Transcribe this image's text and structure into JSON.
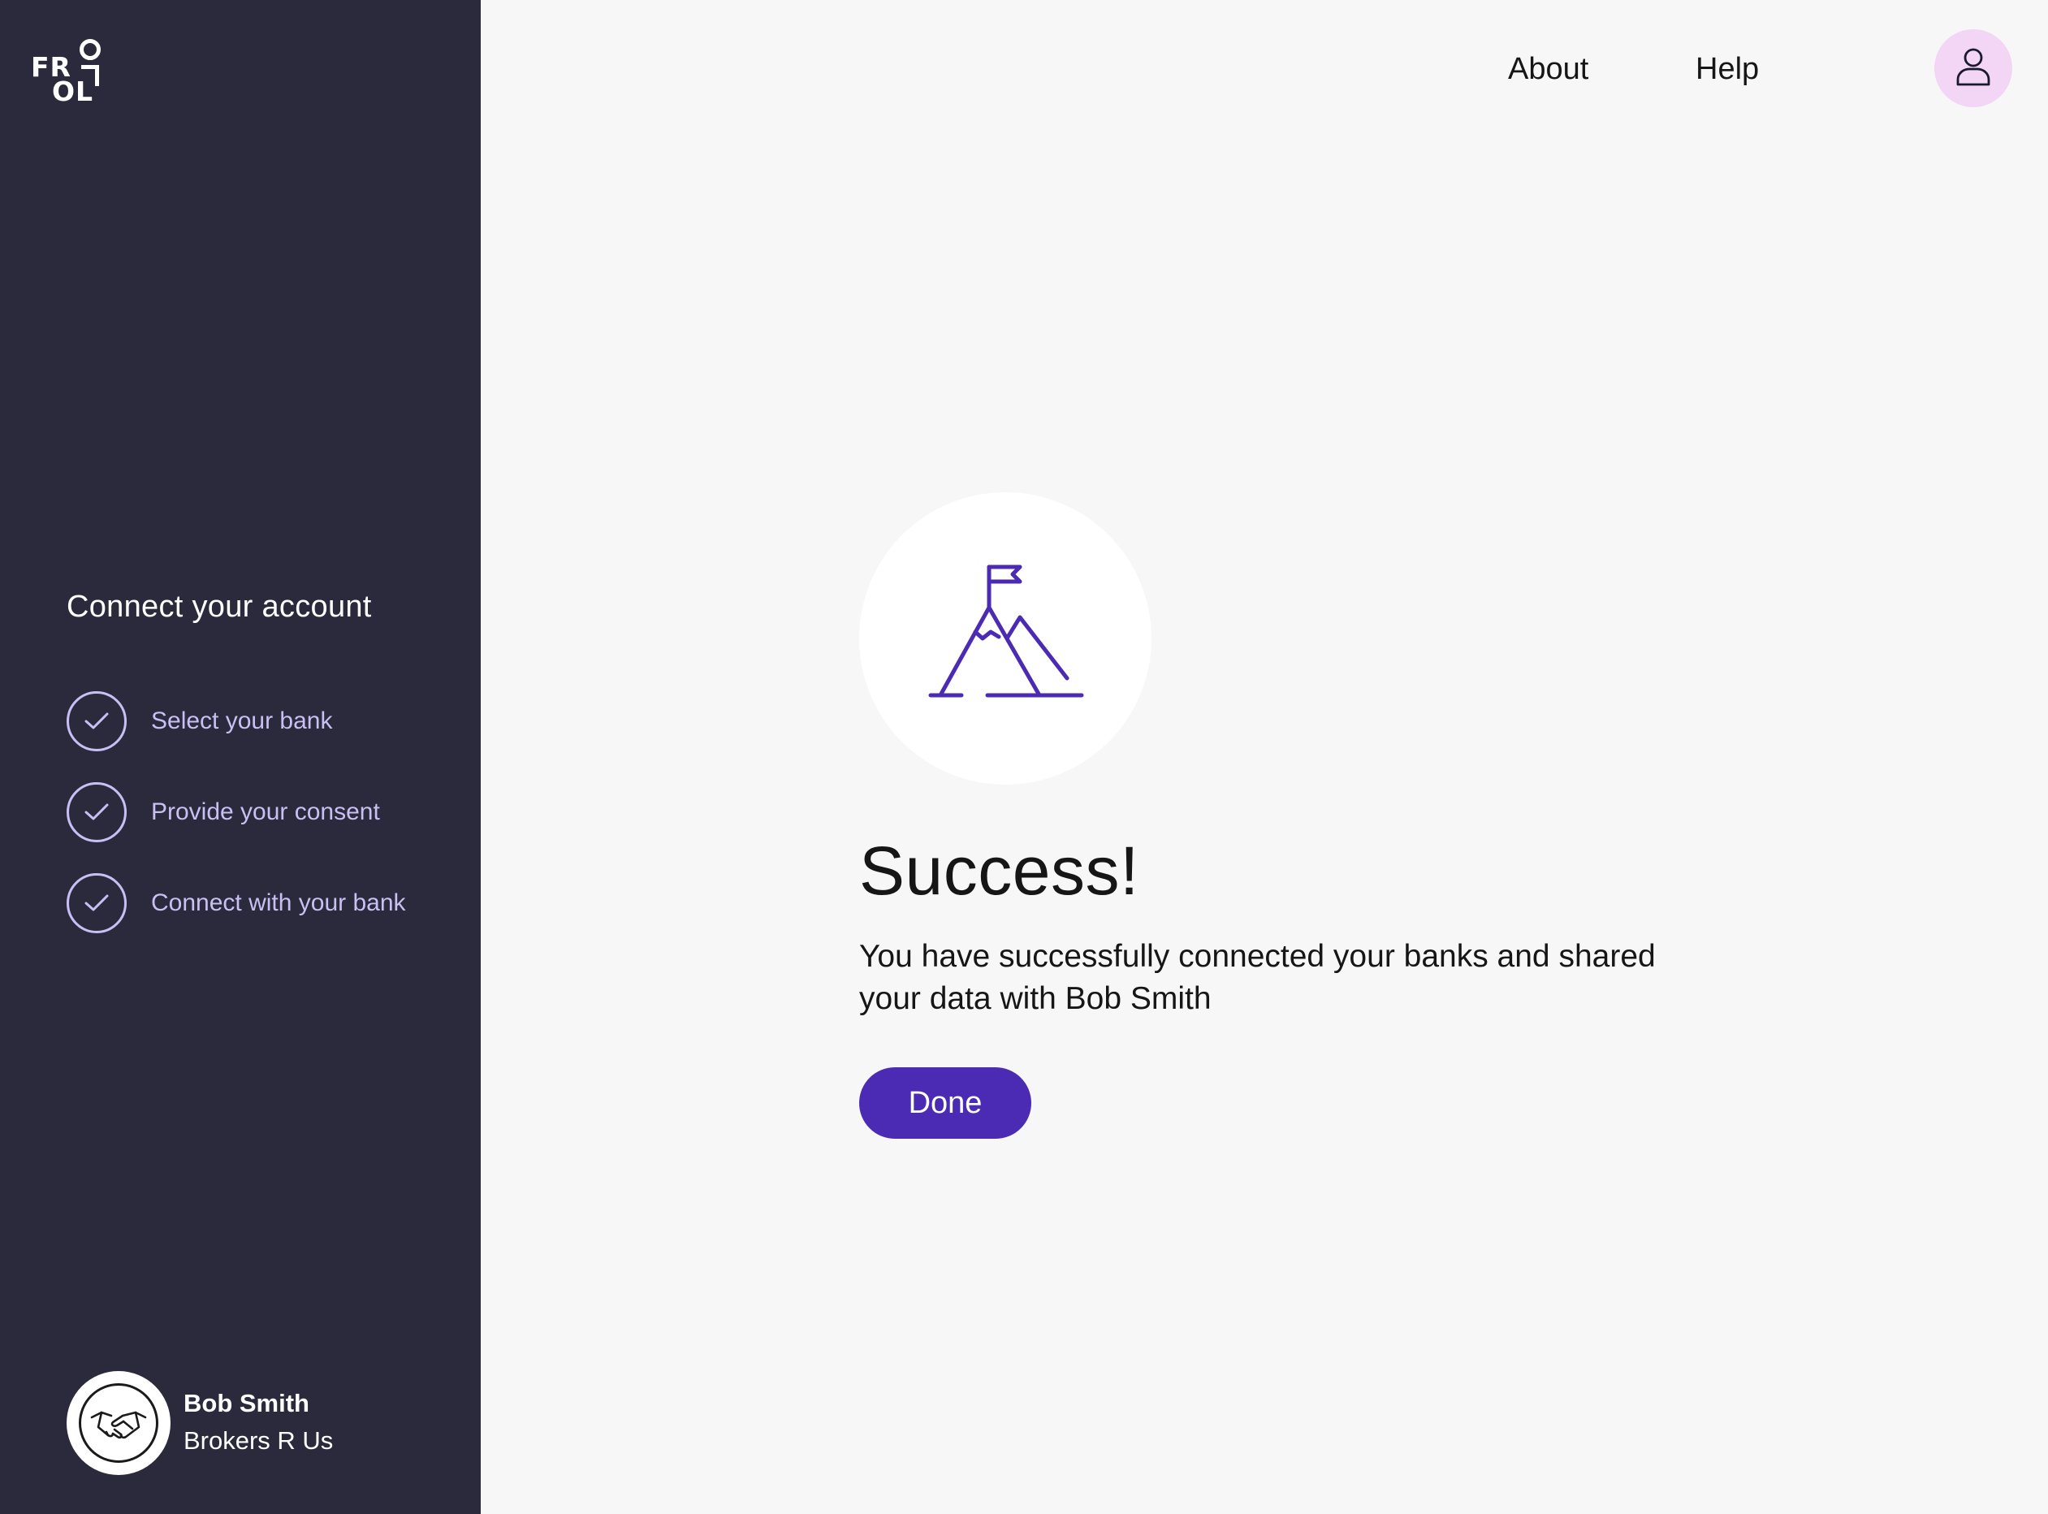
{
  "brand": {
    "logo_text_line1": "FR",
    "logo_text_line2": "OL",
    "logo_name": "FROLLO"
  },
  "sidebar": {
    "title": "Connect your account",
    "steps": [
      {
        "label": "Select your bank",
        "status": "complete",
        "icon": "check-icon"
      },
      {
        "label": "Provide your consent",
        "status": "complete",
        "icon": "check-icon"
      },
      {
        "label": "Connect with your bank",
        "status": "complete",
        "icon": "check-icon"
      }
    ],
    "profile": {
      "name": "Bob Smith",
      "company": "Brokers R Us",
      "avatar_icon": "handshake-icon"
    }
  },
  "nav": {
    "about": "About",
    "help": "Help",
    "user_icon": "user-icon"
  },
  "main": {
    "illustration_icon": "mountain-flag-icon",
    "title": "Success!",
    "message": "You have successfully connected your banks and shared your data with Bob Smith",
    "done_label": "Done"
  },
  "colors": {
    "sidebar_bg": "#2a2a3c",
    "page_bg": "#f7f7f7",
    "accent": "#4b2bb3",
    "step_lavender": "#c9bff2",
    "user_button_bg": "#f3d6f5"
  }
}
